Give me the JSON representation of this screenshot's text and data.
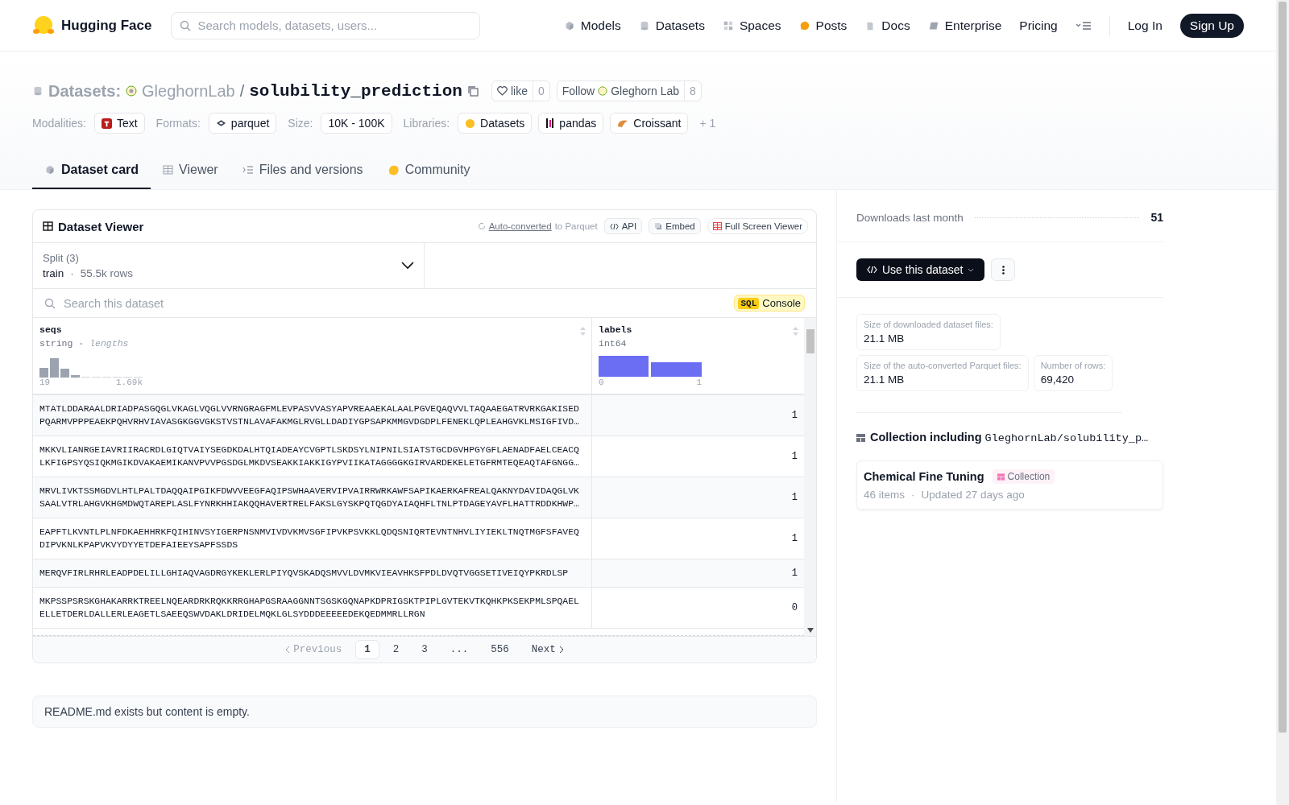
{
  "header": {
    "brand": "Hugging Face",
    "search": {
      "placeholder": "Search models, datasets, users..."
    },
    "nav": [
      {
        "label": "Models"
      },
      {
        "label": "Datasets"
      },
      {
        "label": "Spaces"
      },
      {
        "label": "Posts"
      },
      {
        "label": "Docs"
      },
      {
        "label": "Enterprise"
      },
      {
        "label": "Pricing"
      }
    ],
    "login": "Log In",
    "signup": "Sign Up"
  },
  "repo": {
    "type_label": "Datasets:",
    "owner": "GleghornLab",
    "separator": "/",
    "name": "solubility_prediction",
    "like": {
      "label": "like",
      "count": "0"
    },
    "follow": {
      "label": "Follow",
      "org": "Gleghorn Lab",
      "count": "8"
    }
  },
  "tag_groups": [
    {
      "label": "Modalities:",
      "chips": [
        "Text"
      ]
    },
    {
      "label": "Formats:",
      "chips": [
        "parquet"
      ]
    },
    {
      "label": "Size:",
      "chips": [
        "10K - 100K"
      ]
    },
    {
      "label": "Libraries:",
      "chips": [
        "Datasets",
        "pandas",
        "Croissant"
      ]
    }
  ],
  "more_tags": "+ 1",
  "tabs": [
    {
      "label": "Dataset card",
      "selected": true
    },
    {
      "label": "Viewer",
      "selected": false
    },
    {
      "label": "Files and versions",
      "selected": false
    },
    {
      "label": "Community",
      "selected": false
    }
  ],
  "viewer": {
    "title": "Dataset Viewer",
    "auto_link": "Auto-converted",
    "auto_rest": "to Parquet",
    "buttons": [
      "API",
      "Embed",
      "Full Screen Viewer"
    ],
    "split": {
      "label": "Split (3)",
      "value": "train",
      "dot": "·",
      "rows": "55.5k rows"
    },
    "search": {
      "placeholder": "Search this dataset"
    },
    "sql": {
      "badge": "SQL",
      "label": "Console"
    },
    "columns": [
      {
        "name": "seqs",
        "type": "string",
        "dot": "·",
        "extra": "lengths",
        "min": "19",
        "max": "1.69k"
      },
      {
        "name": "labels",
        "type": "int64",
        "min": "0",
        "max": "1"
      }
    ],
    "rows": [
      {
        "seqs": "MTATLDDARAALDRIADPASGQGLVKAGLVQGLVVRNGRAGFMLEVPASVVASYAPVREAAEKALAALPGVEQAQVVLTAQAAEGATRVRKGAKISEDPQARMVPPPEAEKPQHVRHVIAVASGKGGVGKSTVSTNLAVAFAKMGLRVGLLDADIYGPSAPKMMGVDGDPLFENEKLQPLEAHGVKLMSIGFIVD…",
        "labels": "1"
      },
      {
        "seqs": "MKKVLIANRGEIAVRIIRACRDLGIQTVAIYSEGDKDALHTQIADEAYCVGPTLSKDSYLNIPNILSIATSTGCDGVHPGYGFLAENADFAELCEACQLKFIGPSYQSIQKMGIKDVAKAEMIKANVPVVPGSDGLMKDVSEAKKIAKKIGYPVIIKATAGGGGKGIRVARDEKELETGFRMTEQEAQTAFGNGG…",
        "labels": "1"
      },
      {
        "seqs": "MRVLIVKTSSMGDVLHTLPALTDAQQAIPGIKFDWVVEEGFAQIPSWHAAVERVIPVAIRRWRKAWFSAPIKAERKAFREALQAKNYDAVIDAQGLVKSAALVTRLAHGVKHGMDWQTAREPLASLFYNRKHHIAKQQHAVERTRELFAKSLGYSKPQTQGDYAIAQHFLTNLPTDAGEYAVFLHATTRDDKHWP…",
        "labels": "1"
      },
      {
        "seqs": "EAPFTLKVNTLPLNFDKAEHHRKFQIHINVSYIGERPNSNMVIVDVKMVSGFIPVKPSVKKLQDQSNIQRTEVNTNHVLIYIEKLTNQTMGFSFAVEQDIPVKNLKPAPVKVYDYYETDEFAIEEYSAPFSSDS",
        "labels": "1"
      },
      {
        "seqs": "MERQVFIRLRHRLEADPDELILLGHIAQVAGDRGYKEKLERLPIYQVSKADQSMVVLDVMKVIEAVHKSFPDLDVQTVGGSETIVEIQYPKRDLSP",
        "labels": "1"
      },
      {
        "seqs": "MKPSSPSRSKGHAKARRKTREELNQEARDRKRQKKRRGHAPGSRAAGGNNTSGSKGQNAPKDPRIGSKTPIPLGVTEKVTKQHKPKSEKPMLSPQAELELLETDERLDALLERLEAGETLSAEEQSWVDAKLDRIDELMQKLGLSYDDDEEEEEDEKQEDMMRLLRGN",
        "labels": "0"
      }
    ],
    "pagination": [
      {
        "kind": "prev",
        "label": "Previous",
        "selected": false,
        "disabled": true
      },
      {
        "kind": "page",
        "label": "1",
        "selected": true,
        "disabled": false
      },
      {
        "kind": "page",
        "label": "2",
        "selected": false,
        "disabled": false
      },
      {
        "kind": "page",
        "label": "3",
        "selected": false,
        "disabled": false
      },
      {
        "kind": "gap",
        "label": "...",
        "selected": false,
        "disabled": false
      },
      {
        "kind": "page",
        "label": "556",
        "selected": false,
        "disabled": false
      },
      {
        "kind": "next",
        "label": "Next",
        "selected": false,
        "disabled": false
      }
    ]
  },
  "readme_note": "README.md exists but content is empty.",
  "sidebar": {
    "downloads": {
      "label": "Downloads last month",
      "value": "51"
    },
    "use_button": "Use this dataset",
    "stats": [
      {
        "label": "Size of downloaded dataset files:",
        "value": "21.1 MB"
      },
      {
        "label": "Size of the auto-converted Parquet files:",
        "value": "21.1 MB"
      },
      {
        "label": "Number of rows:",
        "value": "69,420"
      }
    ],
    "collection_heading": {
      "prefix": "Collection including",
      "repo": "GleghornLab/solubility_p…"
    },
    "collection": {
      "title": "Chemical Fine Tuning",
      "badge": "Collection",
      "items": "46 items",
      "dot": "·",
      "updated": "Updated 27 days ago"
    }
  }
}
